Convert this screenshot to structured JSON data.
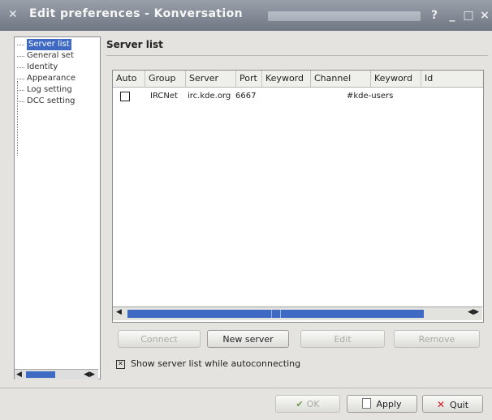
{
  "window": {
    "title": "Edit preferences - Konversation"
  },
  "tree": {
    "items": [
      "Server list",
      "General set",
      "Identity",
      "Appearance",
      "Log setting",
      "DCC setting"
    ],
    "selected_index": 0
  },
  "panel": {
    "title": "Server list"
  },
  "table": {
    "headers": [
      "Auto",
      "Group",
      "Server",
      "Port",
      "Keyword",
      "Channel",
      "Keyword",
      "Id"
    ],
    "rows": [
      {
        "auto": false,
        "group": "IRCNet",
        "server": "irc.kde.org",
        "port": "6667",
        "keyword": "",
        "channel": "#kde-users",
        "keyword2": "",
        "id": ""
      }
    ]
  },
  "buttons": {
    "connect": "Connect",
    "new_server": "New server",
    "edit": "Edit",
    "remove": "Remove",
    "ok": "OK",
    "apply": "Apply",
    "quit": "Quit"
  },
  "options": {
    "show_list_label": "Show server list while autoconnecting",
    "show_list_checked": true
  }
}
